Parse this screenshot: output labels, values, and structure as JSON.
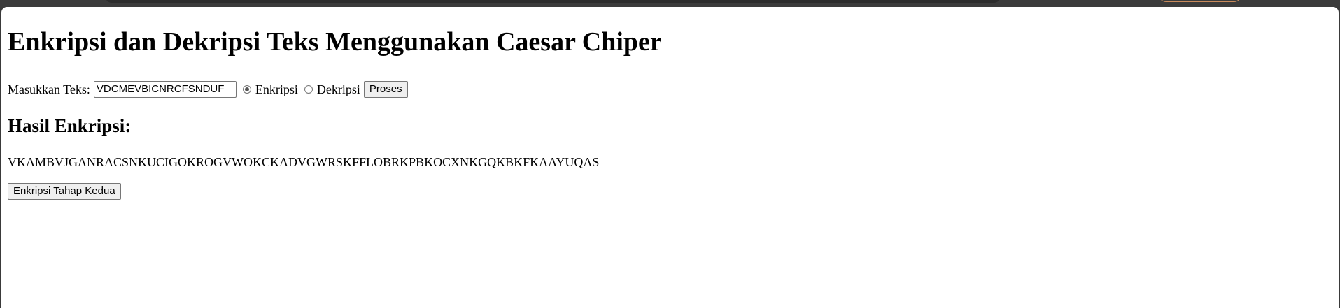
{
  "page": {
    "title": "Enkripsi dan Dekripsi Teks Menggunakan Caesar Chiper"
  },
  "form": {
    "input_label": "Masukkan Teks:",
    "input_value": "VDCMEVBICNRCFSNDUF",
    "radio_encrypt_label": "Enkripsi",
    "radio_decrypt_label": "Dekripsi",
    "selected_mode": "Enkripsi",
    "submit_label": "Proses"
  },
  "result": {
    "heading": "Hasil Enkripsi:",
    "text": "VKAMBVJGANRACSNKUCIGOKROGVWOKCKADVGWRSKFFLOBRKPBKOCXNKGQKBKFKAAYUQAS",
    "next_stage_label": "Enkripsi Tahap Kedua"
  }
}
